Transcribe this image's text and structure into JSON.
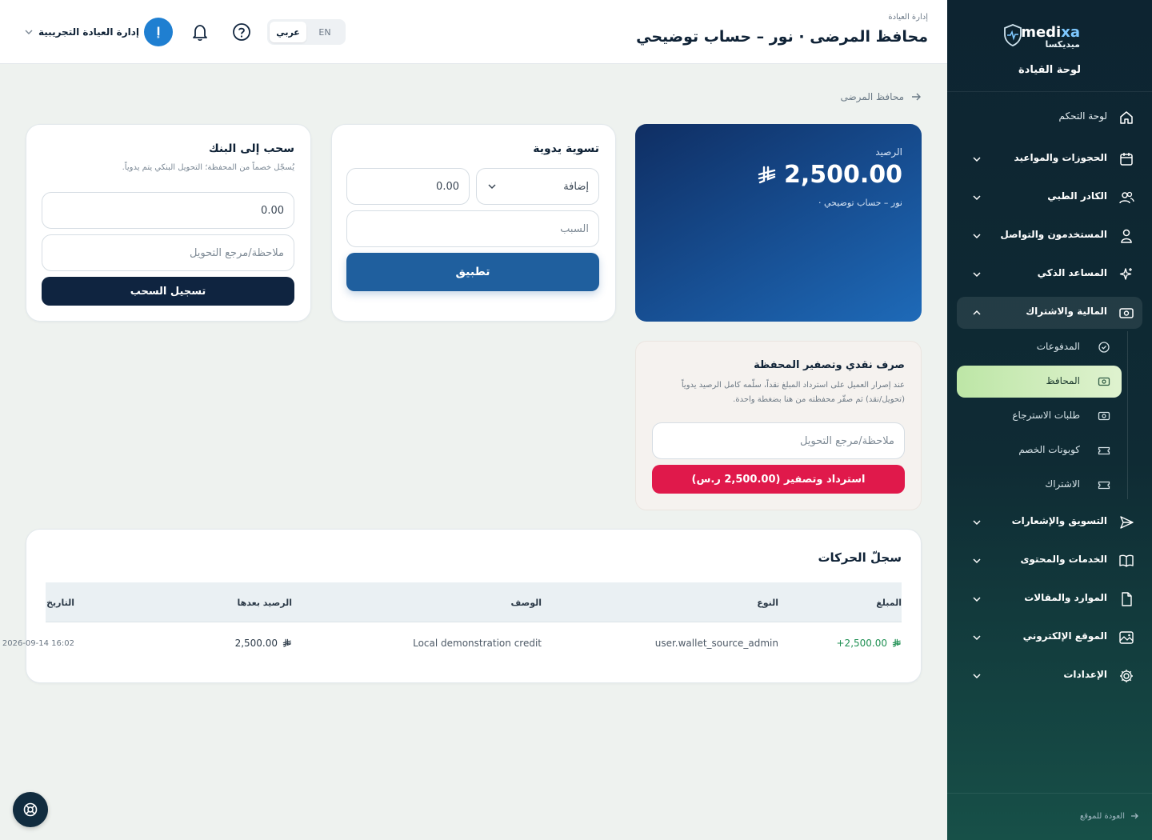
{
  "brand": {
    "name_part1": "medi",
    "name_part2": "xa",
    "name_ar": "ميديكسا",
    "section_title": "لوحة القيادة"
  },
  "sidebar": {
    "items": [
      {
        "label": "لوحة التحكم",
        "icon": "home-icon"
      },
      {
        "label": "الحجوزات والمواعيد",
        "icon": "calendar-icon"
      },
      {
        "label": "الكادر الطبي",
        "icon": "users-icon"
      },
      {
        "label": "المستخدمون والتواصل",
        "icon": "user-icon"
      },
      {
        "label": "المساعد الذكي",
        "icon": "sparkle-icon"
      },
      {
        "label": "المالية والاشتراك",
        "icon": "cash-icon"
      },
      {
        "label": "التسويق والإشعارات",
        "icon": "send-icon"
      },
      {
        "label": "الخدمات والمحتوى",
        "icon": "book-icon"
      },
      {
        "label": "الموارد والمقالات",
        "icon": "file-icon"
      },
      {
        "label": "الموقع الإلكتروني",
        "icon": "image-icon"
      },
      {
        "label": "الإعدادات",
        "icon": "gear-icon"
      }
    ],
    "finance_sub": [
      {
        "label": "المدفوعات",
        "icon": "check-circle-icon"
      },
      {
        "label": "المحافظ",
        "icon": "wallet-icon",
        "active": true
      },
      {
        "label": "طلبات الاسترجاع",
        "icon": "cash-icon"
      },
      {
        "label": "كوبونات الخصم",
        "icon": "ticket-icon"
      },
      {
        "label": "الاشتراك",
        "icon": "ticket-icon"
      }
    ],
    "back_to_site": "العودة للموقع"
  },
  "header": {
    "breadcrumb": "إدارة العيادة",
    "title": "محافظ المرضى · نور – حساب توضيحي",
    "lang_ar": "عربي",
    "lang_en": "EN",
    "user_initial": "إ",
    "user_name": "إدارة العيادة التجريبية"
  },
  "back_link": "محافظ المرضى",
  "balance": {
    "label": "الرصيد",
    "amount": "2,500.00",
    "owner": "نور – حساب توضيحي ·"
  },
  "manual_adjust": {
    "title": "تسوية يدوية",
    "type_value": "إضافة",
    "amount_value": "0.00",
    "reason_placeholder": "السبب",
    "apply_label": "تطبيق"
  },
  "withdraw": {
    "title": "سحب إلى البنك",
    "hint": "يُسجّل خصماً من المحفظة؛ التحويل البنكي يتم يدوياً.",
    "amount_value": "0.00",
    "note_placeholder": "ملاحظة/مرجع التحويل",
    "submit_label": "تسجيل السحب"
  },
  "cashout": {
    "title": "صرف نقدي وتصفير المحفظة",
    "desc": "عند إصرار العميل على استرداد المبلغ نقداً، سلّمه كامل الرصيد يدوياً (تحويل/نقد) ثم صفّر محفظته من هنا بضغطة واحدة.",
    "note_placeholder": "ملاحظة/مرجع التحويل",
    "button_label": "استرداد وتصفير (2,500.00 ر.س)"
  },
  "transactions": {
    "title": "سجلّ الحركات",
    "columns": {
      "amount": "المبلغ",
      "type": "النوع",
      "desc": "الوصف",
      "after": "الرصيد بعدها",
      "date": "التاريخ"
    },
    "rows": [
      {
        "amount": "+2,500.00",
        "type": "user.wallet_source_admin",
        "desc": "Local demonstration credit",
        "after": "2,500.00",
        "date": "2026-09-14 16:02"
      }
    ]
  },
  "colors": {
    "primary": "#1f5f9e",
    "dark": "#0f2236",
    "danger": "#e0194b",
    "success": "#1e8f52",
    "sidebar": "#0d2431"
  }
}
